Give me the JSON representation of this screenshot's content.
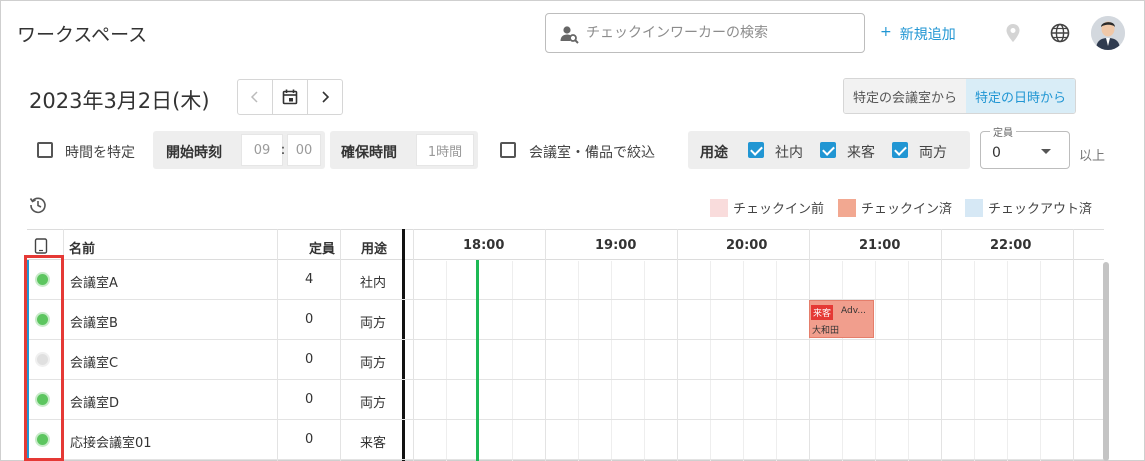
{
  "header": {
    "title": "ワークスペース",
    "search_placeholder": "チェックインワーカーの検索",
    "add_label": "新規追加",
    "add_icon": "+"
  },
  "date_bar": {
    "date": "2023年3月2日(木)",
    "from_room": "特定の会議室から",
    "from_datetime": "特定の日時から"
  },
  "filters": {
    "time_specific": "時間を特定",
    "start_time_label": "開始時刻",
    "hour": "09",
    "colon": ":",
    "minute": "00",
    "duration_label": "確保時間",
    "duration_value": "1時間",
    "narrow_label": "会議室・備品で絞込",
    "usage_label": "用途",
    "usage_internal": "社内",
    "usage_visitor": "来客",
    "usage_both": "両方",
    "capacity_legend": "定員",
    "capacity_value": "0",
    "capacity_suffix": "以上"
  },
  "legend": {
    "before": "チェックイン前",
    "checked_in": "チェックイン済",
    "checked_out": "チェックアウト済",
    "colors": {
      "before": "#f9dcdc",
      "checked_in": "#f2a891",
      "checked_out": "#d6e8f5"
    }
  },
  "table": {
    "col_name": "名前",
    "col_capacity": "定員",
    "col_usage": "用途",
    "times": [
      "18:00",
      "19:00",
      "20:00",
      "21:00",
      "22:00"
    ],
    "rows": [
      {
        "name": "会議室A",
        "capacity": "4",
        "usage": "社内",
        "status": "on"
      },
      {
        "name": "会議室B",
        "capacity": "0",
        "usage": "両方",
        "status": "on"
      },
      {
        "name": "会議室C",
        "capacity": "0",
        "usage": "両方",
        "status": "off"
      },
      {
        "name": "会議室D",
        "capacity": "0",
        "usage": "両方",
        "status": "on"
      },
      {
        "name": "応接会議室01",
        "capacity": "0",
        "usage": "来客",
        "status": "on"
      }
    ]
  },
  "event": {
    "tag": "来客",
    "title": "Adv...",
    "person": "大和田"
  }
}
